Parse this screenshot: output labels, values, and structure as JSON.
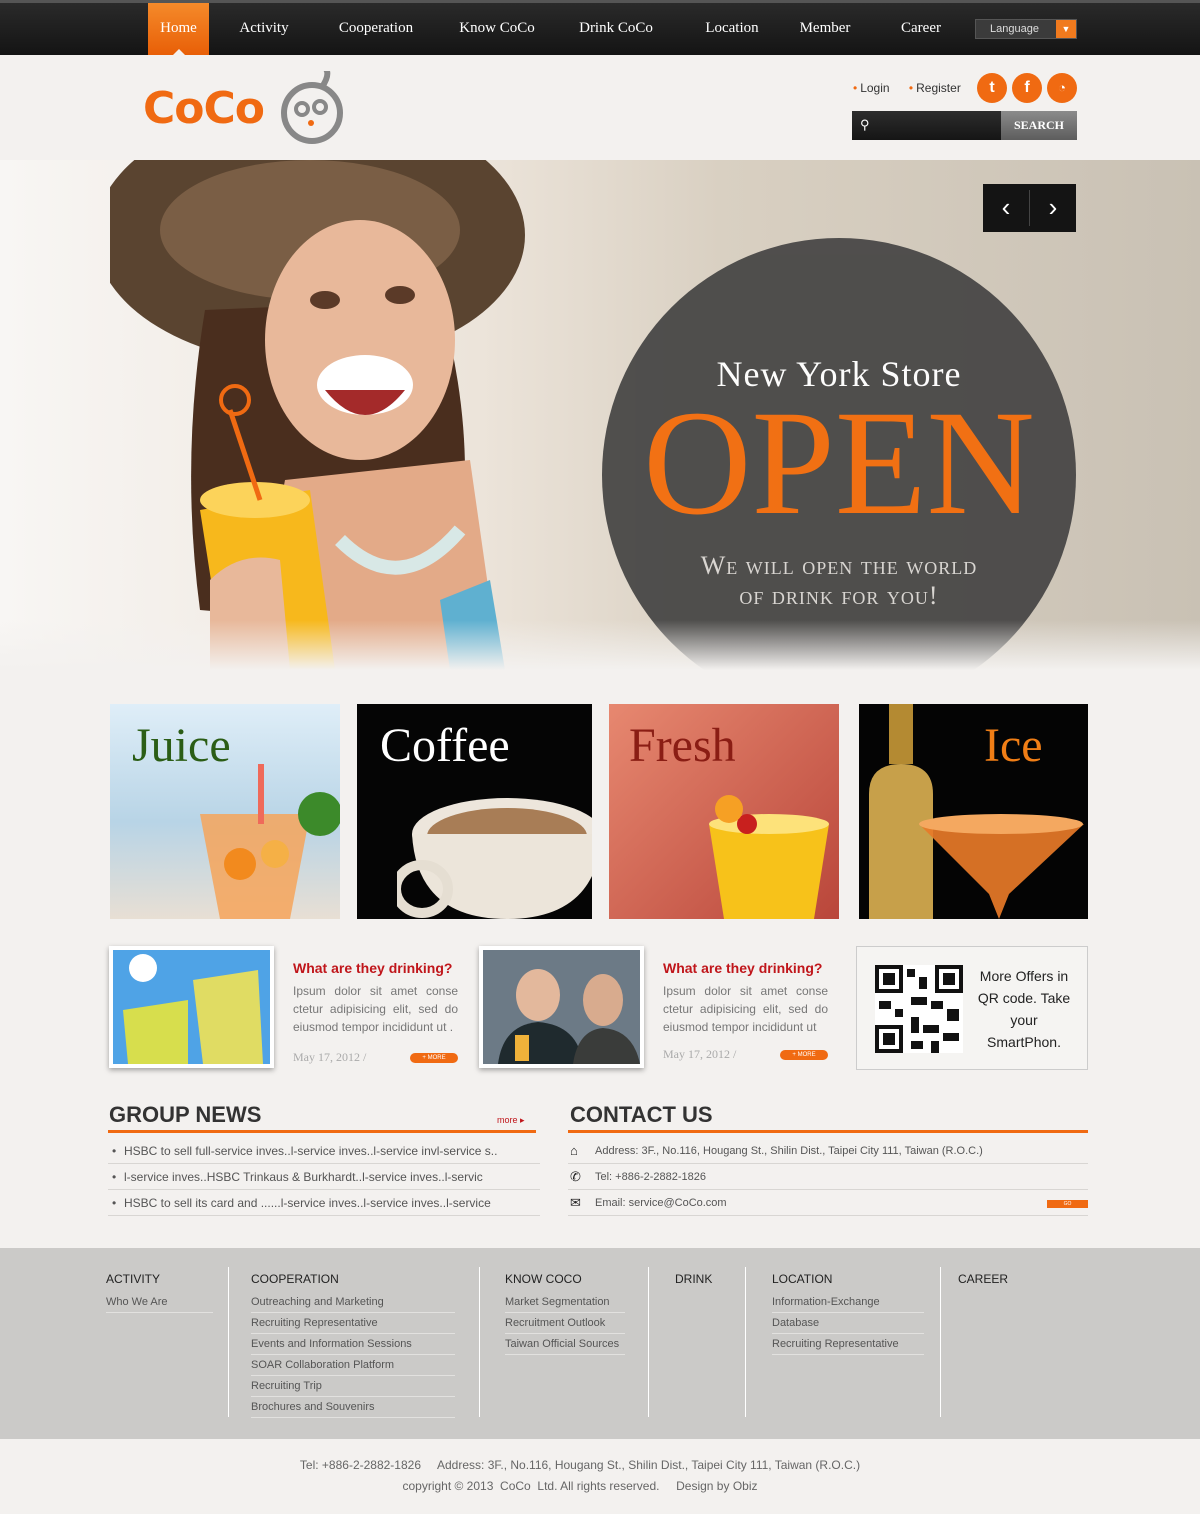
{
  "nav": {
    "items": [
      "Home",
      "Activity",
      "Cooperation",
      "Know CoCo",
      "Drink CoCo",
      "Location",
      "Member",
      "Career"
    ],
    "language": "Language"
  },
  "header": {
    "logo_text": "CoCo",
    "login": "Login",
    "register": "Register",
    "search_button": "SEARCH",
    "search_placeholder": ""
  },
  "banner": {
    "line1": "New York Store",
    "line2": "OPEN",
    "line3a": "We will open the world",
    "line3b": "of drink for you!"
  },
  "categories": [
    "Juice",
    "Coffee",
    "Fresh",
    "Ice"
  ],
  "news": [
    {
      "title": "What are they drinking?",
      "body": "Ipsum dolor sit amet conse ctetur adipisicing elit, sed do eiusmod tempor incididunt ut .",
      "date": "May 17, 2012 /",
      "more": "+ MORE"
    },
    {
      "title": "What are they drinking?",
      "body": "Ipsum dolor sit amet conse ctetur adipisicing elit, sed do eiusmod tempor incididunt ut",
      "date": "May 17, 2012 /",
      "more": "+ MORE"
    }
  ],
  "qr": {
    "text": "More Offers in QR code. Take your SmartPhon."
  },
  "group_news": {
    "title": "GROUP NEWS",
    "more": "more",
    "items": [
      "HSBC to sell full-service inves..l-service inves..l-service invl-service s..",
      "l-service inves..HSBC Trinkaus & Burkhardt..l-service inves..l-servic",
      "HSBC to sell its card and ......l-service inves..l-service inves..l-service"
    ]
  },
  "contact": {
    "title": "CONTACT US",
    "address": "Address: 3F., No.116, Hougang St., Shilin Dist., Taipei City 111, Taiwan (R.O.C.)",
    "tel": "Tel: +886-2-2882-1826",
    "email": "Email: service@CoCo.com",
    "go": "GO"
  },
  "footer": {
    "cols": [
      {
        "head": "ACTIVITY",
        "items": [
          "Who We Are"
        ]
      },
      {
        "head": "COOPERATION",
        "items": [
          "Outreaching and Marketing",
          "Recruiting Representative",
          "Events and Information Sessions",
          "SOAR Collaboration Platform",
          "Recruiting Trip",
          "Brochures and Souvenirs"
        ]
      },
      {
        "head": "KNOW COCO",
        "items": [
          "Market Segmentation",
          "Recruitment Outlook",
          "Taiwan Official Sources"
        ]
      },
      {
        "head": "DRINK",
        "items": []
      },
      {
        "head": "LOCATION",
        "items": [
          "Information-Exchange",
          "Database",
          "Recruiting Representative"
        ]
      },
      {
        "head": "CAREER",
        "items": []
      }
    ]
  },
  "bottom": {
    "line1": "Tel: +886-2-2882-1826     Address: 3F., No.116, Hougang St., Shilin Dist., Taipei City 111, Taiwan (R.O.C.)",
    "line2": "copyright © 2013  CoCo  Ltd. All rights reserved.     Design by Obiz"
  },
  "colors": {
    "accent": "#f06a12",
    "nav_bg": "#1b1b1b",
    "news_title": "#c0161b"
  }
}
